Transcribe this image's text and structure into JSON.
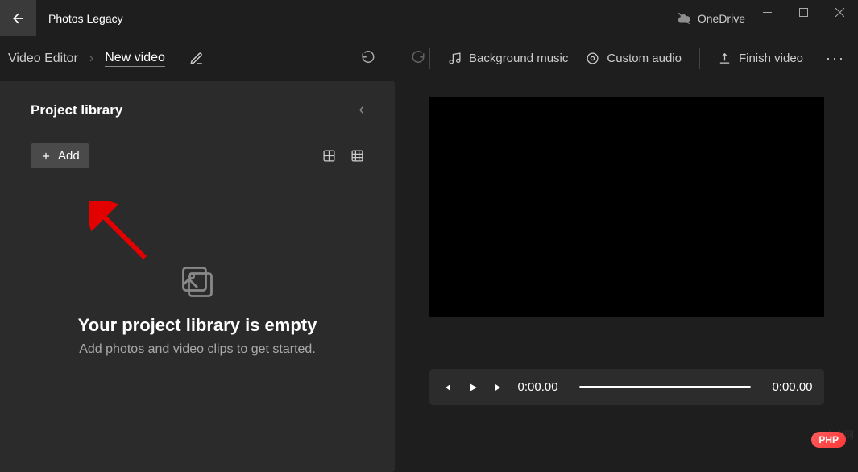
{
  "app_title": "Photos Legacy",
  "cloud": {
    "label": "OneDrive"
  },
  "breadcrumb": {
    "section": "Video Editor",
    "separator": "›",
    "project_name": "New video"
  },
  "toolbar": {
    "bg_music": "Background music",
    "custom_audio": "Custom audio",
    "finish": "Finish video"
  },
  "library": {
    "title": "Project library",
    "add_label": "Add",
    "empty_title": "Your project library is empty",
    "empty_sub": "Add photos and video clips to get started."
  },
  "player": {
    "time_start": "0:00.00",
    "time_end": "0:00.00"
  },
  "badge": "PHP",
  "watermark": "中文网"
}
